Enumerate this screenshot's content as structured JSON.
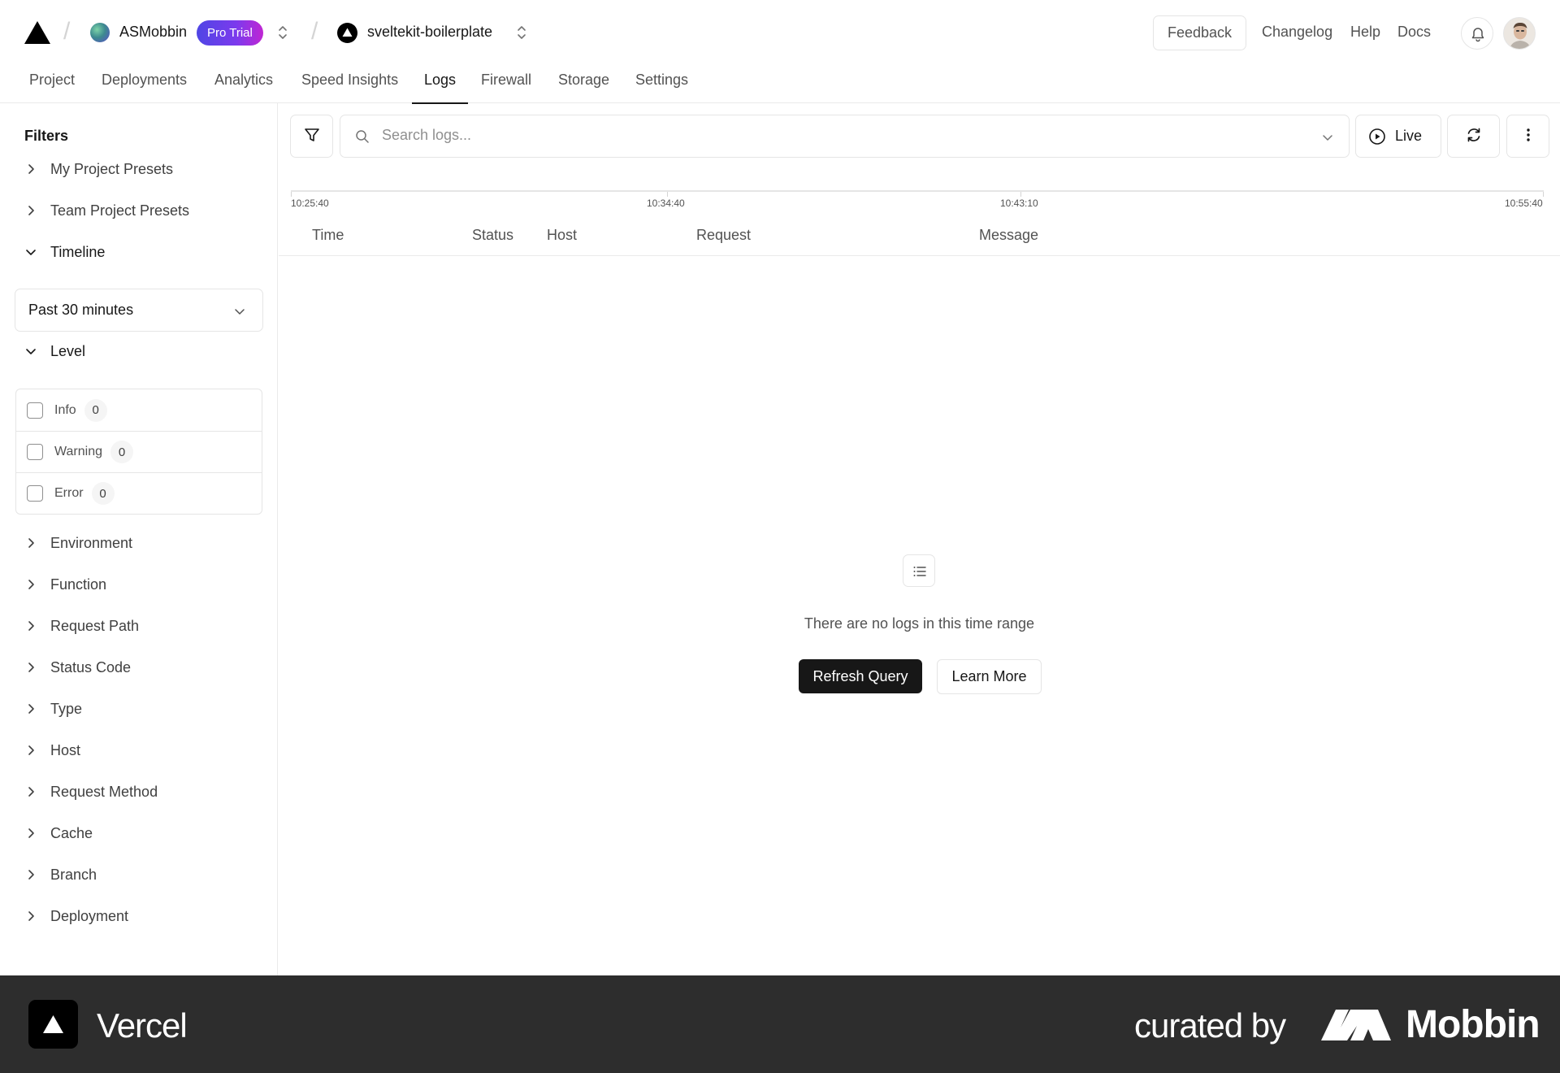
{
  "header": {
    "team_name": "ASMobbin",
    "plan_badge": "Pro Trial",
    "project_name": "sveltekit-boilerplate",
    "feedback_label": "Feedback",
    "links": [
      "Changelog",
      "Help",
      "Docs"
    ]
  },
  "tabs": [
    "Project",
    "Deployments",
    "Analytics",
    "Speed Insights",
    "Logs",
    "Firewall",
    "Storage",
    "Settings"
  ],
  "active_tab": "Logs",
  "sidebar": {
    "title": "Filters",
    "presets": [
      "My Project Presets",
      "Team Project Presets"
    ],
    "timeline": {
      "label": "Timeline",
      "value": "Past 30 minutes"
    },
    "level": {
      "label": "Level",
      "options": [
        {
          "label": "Info",
          "count": "0",
          "checked": false
        },
        {
          "label": "Warning",
          "count": "0",
          "checked": false
        },
        {
          "label": "Error",
          "count": "0",
          "checked": false
        }
      ]
    },
    "sections": [
      "Environment",
      "Function",
      "Request Path",
      "Status Code",
      "Type",
      "Host",
      "Request Method",
      "Cache",
      "Branch",
      "Deployment"
    ]
  },
  "toolbar": {
    "search_placeholder": "Search logs...",
    "live_label": "Live"
  },
  "timeline_ticks": [
    "10:25:40",
    "10:34:40",
    "10:43:10",
    "10:55:40"
  ],
  "table": {
    "columns": [
      "Time",
      "Status",
      "Host",
      "Request",
      "Message"
    ]
  },
  "empty_state": {
    "message": "There are no logs in this time range",
    "primary_action": "Refresh Query",
    "secondary_action": "Learn More"
  },
  "footer": {
    "app_name": "Vercel",
    "curated_text": "curated by",
    "curator_name": "Mobbin"
  },
  "colors": {
    "text_primary": "#171717",
    "text_secondary": "#525252",
    "border": "#e5e5e5",
    "badge_gradient_start": "#4f46e5",
    "badge_gradient_end": "#c026d3",
    "footer_bg": "#2d2d2d"
  },
  "icons": {
    "logo": "triangle-logo-icon",
    "switcher": "chevron-up-down-icon",
    "notifications": "bell-icon",
    "filter": "filter-icon",
    "search": "search-icon",
    "live": "play-circle-icon",
    "refresh": "refresh-icon",
    "more": "more-vertical-icon",
    "empty": "list-icon"
  }
}
